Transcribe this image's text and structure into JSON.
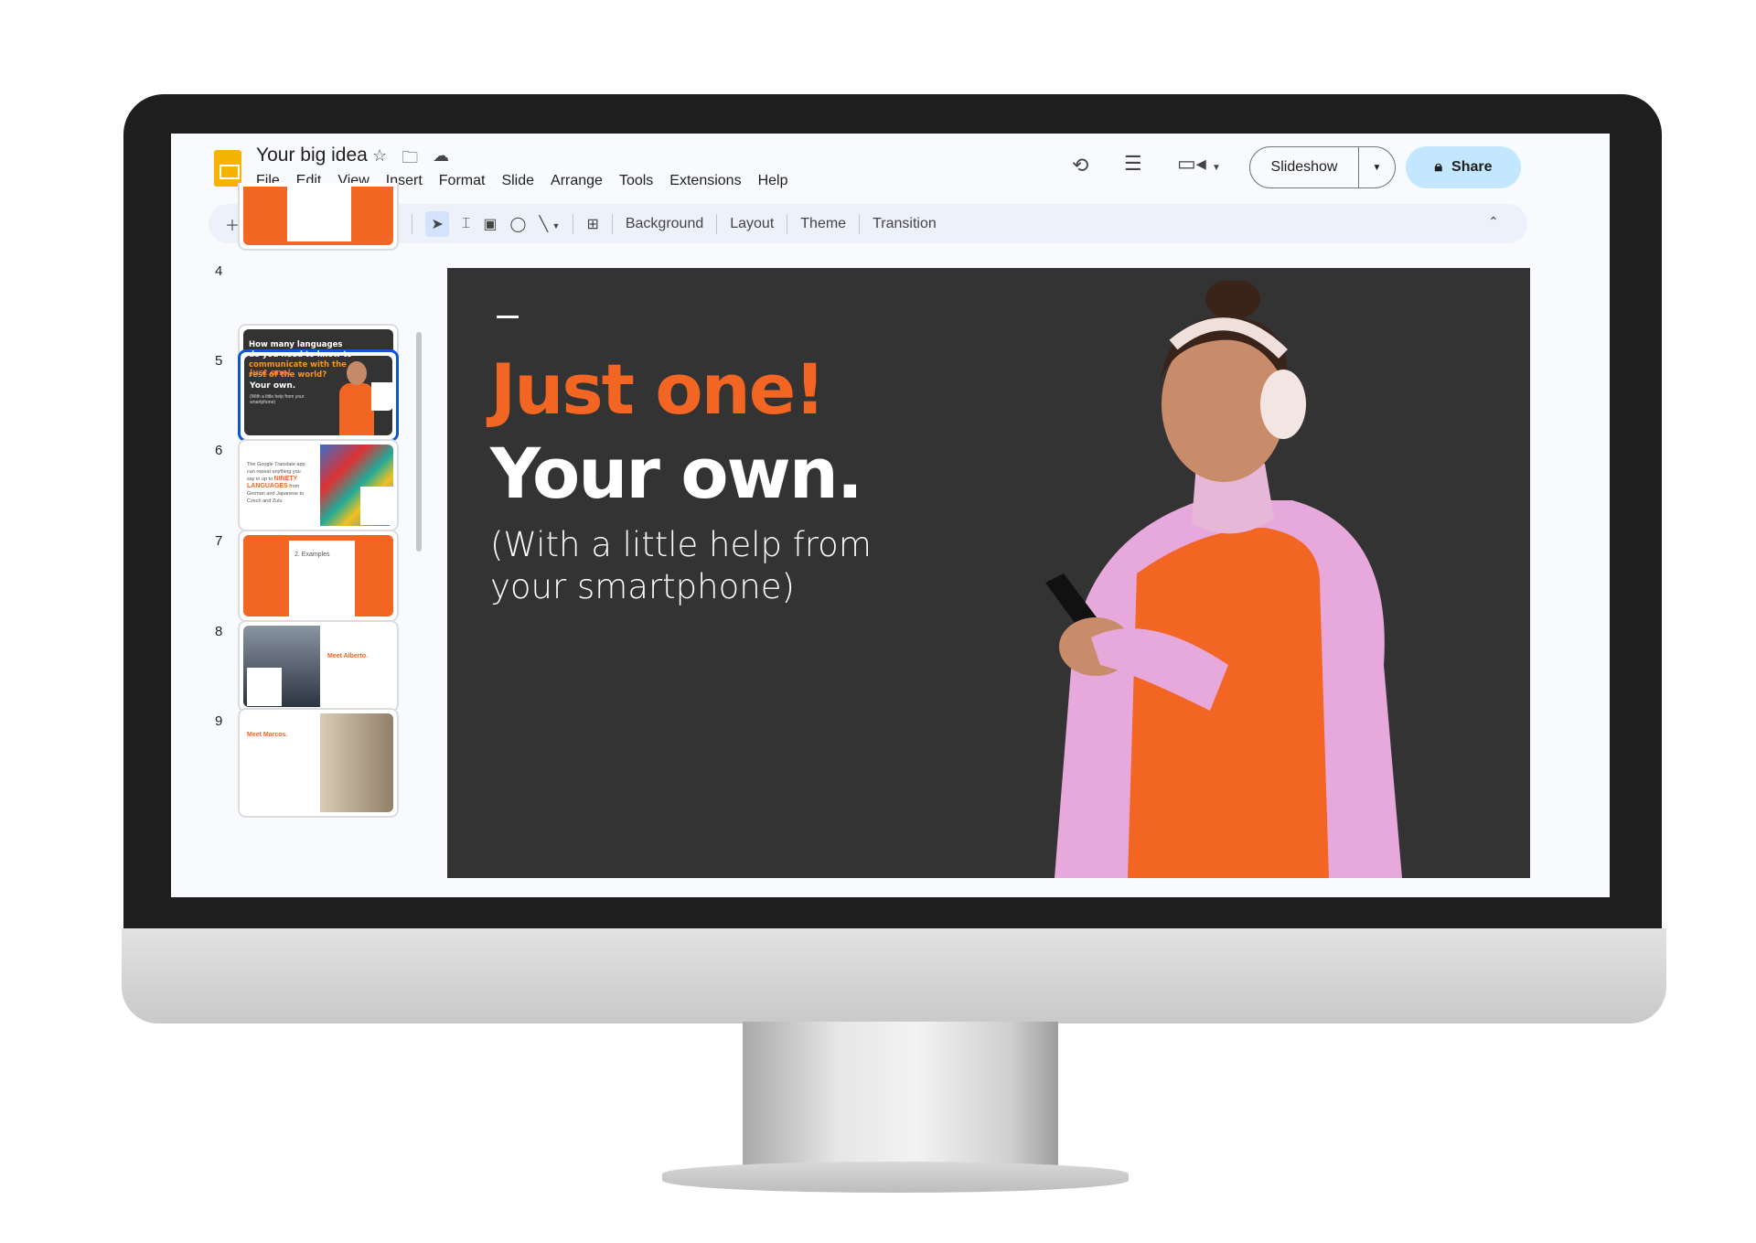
{
  "app": {
    "title": "Your big idea",
    "menu": [
      "File",
      "Edit",
      "View",
      "Insert",
      "Format",
      "Slide",
      "Arrange",
      "Tools",
      "Extensions",
      "Help"
    ]
  },
  "header": {
    "slideshow_label": "Slideshow",
    "share_label": "Share"
  },
  "toolbar": {
    "background": "Background",
    "layout": "Layout",
    "theme": "Theme",
    "transition": "Transition"
  },
  "filmstrip": {
    "slides": [
      {
        "number": "4",
        "line1": "How many languages do you need to know to",
        "line2": "communicate with the rest of the world?"
      },
      {
        "number": "5",
        "title": "Just one!",
        "subtitle": "Your own.",
        "body": "(With a little help from your smartphone)"
      },
      {
        "number": "6",
        "text": "The Google Translate app can repeat anything you say in up to",
        "highlight": "NINETY LANGUAGES",
        "text2": "from German and Japanese to Czech and Zulu"
      },
      {
        "number": "7",
        "title": "2. Examples"
      },
      {
        "number": "8",
        "title": "Meet Alberto."
      },
      {
        "number": "9",
        "title": "Meet Marcos."
      }
    ]
  },
  "slide": {
    "title": "Just one!",
    "subtitle": "Your own.",
    "body": "(With a little help from your smartphone)"
  },
  "colors": {
    "accent": "#f26522",
    "slide_bg": "#333333",
    "selected": "#0b57d0",
    "share_bg": "#c2e7ff"
  }
}
